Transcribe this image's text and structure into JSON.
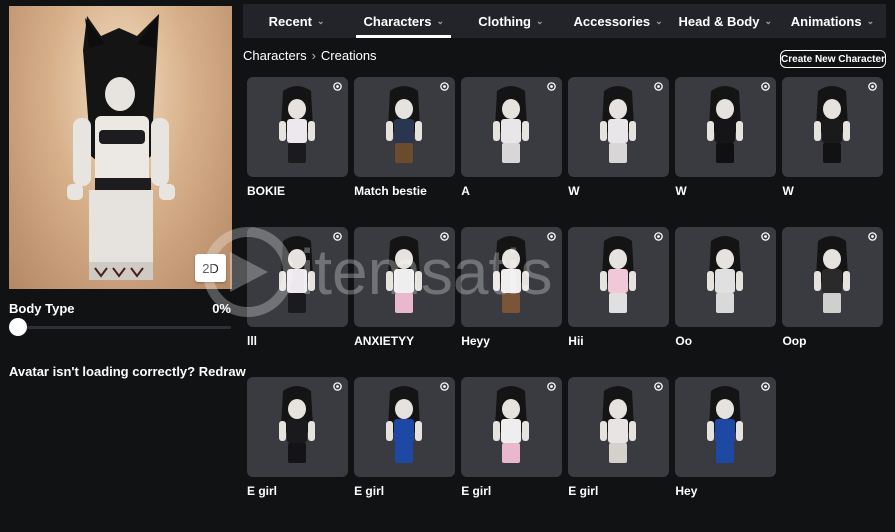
{
  "avatar": {
    "view_toggle_label": "2D",
    "body_type_label": "Body Type",
    "body_type_value": "0%",
    "body_type_level": 0,
    "loading_question": "Avatar isn't loading correctly?",
    "redraw_label": "Redraw"
  },
  "nav": {
    "tabs": [
      {
        "label": "Recent"
      },
      {
        "label": "Characters"
      },
      {
        "label": "Clothing"
      },
      {
        "label": "Accessories"
      },
      {
        "label": "Head & Body"
      },
      {
        "label": "Animations"
      }
    ],
    "active_tab": "Characters"
  },
  "breadcrumb": {
    "parent": "Characters",
    "current": "Creations"
  },
  "create_button_label": "Create New Character",
  "characters": [
    {
      "name": "BOKIE",
      "outfit": "#ece8ee",
      "pants": "#1b1b1d"
    },
    {
      "name": "Match bestie",
      "outfit": "#2a3550",
      "pants": "#6a4b2e"
    },
    {
      "name": "A",
      "outfit": "#e9e6ea",
      "pants": "#d9d6d8"
    },
    {
      "name": "W",
      "outfit": "#e9e6ea",
      "pants": "#d9d6d8"
    },
    {
      "name": "W",
      "outfit": "#151517",
      "pants": "#101012"
    },
    {
      "name": "W",
      "outfit": "#1a1a1c",
      "pants": "#121214"
    },
    {
      "name": "lll",
      "outfit": "#ece8ee",
      "pants": "#1b1b1d"
    },
    {
      "name": "ANXIETYY",
      "outfit": "#eee",
      "pants": "#e9b8cc"
    },
    {
      "name": "Heyy",
      "outfit": "#eee",
      "pants": "#7a5538"
    },
    {
      "name": "Hii",
      "outfit": "#f0c8d8",
      "pants": "#e0e0e0"
    },
    {
      "name": "Oo",
      "outfit": "#e0e0e0",
      "pants": "#d9d9d9"
    },
    {
      "name": "Oop",
      "outfit": "#2a2a2a",
      "pants": "#cfcfcf"
    },
    {
      "name": "E girl",
      "outfit": "#1a1a1c",
      "pants": "#141416"
    },
    {
      "name": "E girl",
      "outfit": "#1d49a5",
      "pants": "#1d49a5"
    },
    {
      "name": "E girl",
      "outfit": "#eee",
      "pants": "#e9b8cc"
    },
    {
      "name": "E girl",
      "outfit": "#e8e4e4",
      "pants": "#d4d0cc"
    },
    {
      "name": "Hey",
      "outfit": "#1d49a5",
      "pants": "#1d49a5"
    }
  ],
  "colors": {
    "background": "#111214",
    "nav_bar": "#232429",
    "card_bg": "#393b41",
    "preview_bg": "#d7b08a"
  },
  "watermark_text": "itemsatis"
}
